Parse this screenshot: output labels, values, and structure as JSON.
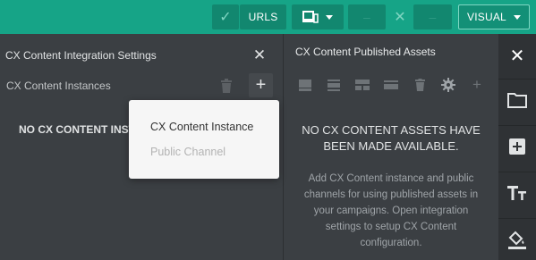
{
  "toolbar": {
    "urls_label": "URLS",
    "visual_label": "VISUAL",
    "check_icon": "check-icon",
    "device_icon": "device-icon",
    "close_icon": "close-icon",
    "accent": "#16a487"
  },
  "left_panel": {
    "title": "CX Content Integration Settings",
    "subtitle": "CX Content Instances",
    "empty_message": "NO CX CONTENT INSTA"
  },
  "dropdown": {
    "items": [
      {
        "label": "CX Content Instance",
        "enabled": true
      },
      {
        "label": "Public Channel",
        "enabled": false
      }
    ]
  },
  "right_panel": {
    "title": "CX Content Published Assets",
    "empty_title_line1": "NO CX CONTENT ASSETS HAVE",
    "empty_title_line2": "BEEN MADE AVAILABLE.",
    "empty_desc": "Add CX Content instance and public channels for using published assets in your campaigns. Open integration settings to setup CX Content configuration."
  },
  "sidebar": {
    "items": [
      "folder-icon",
      "add-box-icon",
      "text-format-icon",
      "paint-bucket-icon"
    ]
  }
}
